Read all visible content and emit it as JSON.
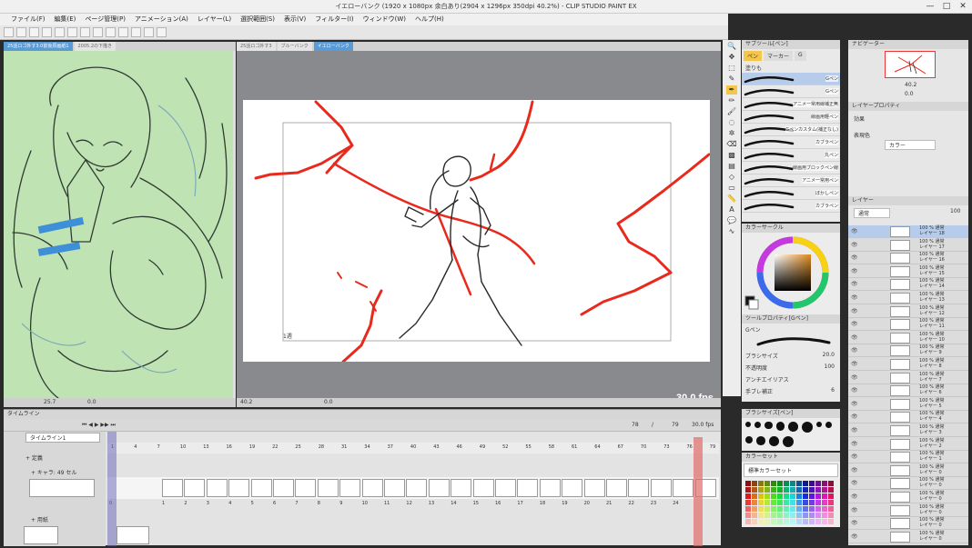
{
  "window": {
    "title": "イエローバンク (1920 x 1080px 余白あり(2904 x 1296px 350dpi 40.2%) - CLIP STUDIO PAINT EX",
    "controls": [
      "—",
      "□",
      "✕"
    ]
  },
  "menu": [
    "ファイル(F)",
    "編集(E)",
    "ページ管理(P)",
    "アニメーション(A)",
    "レイヤー(L)",
    "選択範囲(S)",
    "表示(V)",
    "フィルター(I)",
    "ウィンドウ(W)",
    "ヘルプ(H)"
  ],
  "left_panel": {
    "tabs": [
      "25話ロゴ外す3.0前後原画紙1",
      "2005.2の下描き"
    ],
    "status": {
      "zoom": "25.7",
      "angle": "0.0"
    }
  },
  "canvas": {
    "tabs": [
      "25話ロゴ外す3",
      "ブルーバンク",
      "イエローバンク"
    ],
    "active_tab": "イエローバンク",
    "fps": "30.0 fps",
    "frame_label": "1週",
    "status": {
      "zoom": "40.2",
      "angle": "0.0"
    },
    "line_colors": {
      "red": "#e8291c",
      "dark": "#2a2a2a"
    }
  },
  "timeline": {
    "panel_title": "タイムライン",
    "timeline_name": "タイムライン1",
    "current_frame": "78",
    "end_frame": "79",
    "fps": "30.0 fps",
    "ruler": [
      "1",
      "4",
      "7",
      "10",
      "13",
      "16",
      "19",
      "22",
      "25",
      "28",
      "31",
      "34",
      "37",
      "40",
      "43",
      "46",
      "49",
      "52",
      "55",
      "58",
      "61",
      "64",
      "67",
      "70",
      "73",
      "76",
      "79"
    ],
    "tracks": [
      {
        "name": "+ 定義"
      },
      {
        "name": "+ キャラ: 49 セル"
      },
      {
        "name": "+ 用紙"
      }
    ],
    "cell_numbers": [
      "0",
      "1",
      "2",
      "3",
      "4",
      "5",
      "6",
      "7",
      "8",
      "9",
      "10",
      "11",
      "12",
      "13",
      "14",
      "15",
      "16",
      "17",
      "18",
      "19",
      "20",
      "21",
      "22",
      "23",
      "24"
    ]
  },
  "subtool": {
    "title": "サブツール[ペン]",
    "tabs": [
      "ペン",
      "マーカー",
      "G"
    ],
    "sub_tab": "塗りも",
    "brushes": [
      "Gペン",
      "Gペン",
      "アニメ一常用線補正無",
      "線画用軽ペン",
      "Gペンカスタム(補正なし)",
      "カブラペン",
      "丸ペン",
      "線画用ブロックペン線",
      "アニメ一常用ペン",
      "ぼかしペン",
      "カブラペン"
    ]
  },
  "color_wheel": {
    "title": "カラーサークル",
    "selected_color": "#b06a2a"
  },
  "tool_property": {
    "title": "ツールプロパティ[Gペン]",
    "brush_name": "Gペン",
    "props": [
      {
        "label": "ブラシサイズ",
        "value": "20.0"
      },
      {
        "label": "不透明度",
        "value": "100"
      },
      {
        "label": "アンチエイリアス",
        "value": ""
      },
      {
        "label": "手ブレ補正",
        "value": "6"
      }
    ]
  },
  "brush_size": {
    "title": "ブラシサイズ[ペン]"
  },
  "palette": {
    "title": "カラーセット",
    "set_name": "標準カラーセット"
  },
  "navigator": {
    "title": "ナビゲーター",
    "zoom": "40.2",
    "angle": "0.0"
  },
  "layer_property": {
    "title": "レイヤープロパティ",
    "effect_label": "効果",
    "expression_label": "表現色",
    "expression_value": "カラー"
  },
  "layers": {
    "title": "レイヤー",
    "blend": "通常",
    "opacity": "100",
    "rows": [
      {
        "info": "100 % 通常",
        "name": "レイヤー 18"
      },
      {
        "info": "100 % 通常",
        "name": "レイヤー 17"
      },
      {
        "info": "100 % 通常",
        "name": "レイヤー 16"
      },
      {
        "info": "100 % 通常",
        "name": "レイヤー 15"
      },
      {
        "info": "100 % 通常",
        "name": "レイヤー 14"
      },
      {
        "info": "100 % 通常",
        "name": "レイヤー 13"
      },
      {
        "info": "100 % 通常",
        "name": "レイヤー 12"
      },
      {
        "info": "100 % 通常",
        "name": "レイヤー 11"
      },
      {
        "info": "100 % 通常",
        "name": "レイヤー 10"
      },
      {
        "info": "100 % 通常",
        "name": "レイヤー 9"
      },
      {
        "info": "100 % 通常",
        "name": "レイヤー 8"
      },
      {
        "info": "100 % 通常",
        "name": "レイヤー 7"
      },
      {
        "info": "100 % 通常",
        "name": "レイヤー 6"
      },
      {
        "info": "100 % 通常",
        "name": "レイヤー 5"
      },
      {
        "info": "100 % 通常",
        "name": "レイヤー 4"
      },
      {
        "info": "100 % 通常",
        "name": "レイヤー 3"
      },
      {
        "info": "100 % 通常",
        "name": "レイヤー 2"
      },
      {
        "info": "100 % 通常",
        "name": "レイヤー 1"
      },
      {
        "info": "100 % 通常",
        "name": "レイヤー 0"
      },
      {
        "info": "100 % 通常",
        "name": "レイヤー 0"
      },
      {
        "info": "100 % 通常",
        "name": "レイヤー 0"
      },
      {
        "info": "100 % 通常",
        "name": "レイヤー 0"
      },
      {
        "info": "100 % 通常",
        "name": "レイヤー 0"
      },
      {
        "info": "100 % 通常",
        "name": "レイヤー 0"
      }
    ]
  },
  "icons": {
    "tools": [
      "magnify-icon",
      "move-icon",
      "select-icon",
      "eyedropper-icon",
      "pen-icon",
      "pencil-icon",
      "brush-icon",
      "airbrush-icon",
      "decoration-icon",
      "eraser-icon",
      "fill-icon",
      "gradient-icon",
      "figure-icon",
      "frame-icon",
      "ruler-icon",
      "text-icon",
      "balloon-icon",
      "correct-line-icon"
    ]
  }
}
